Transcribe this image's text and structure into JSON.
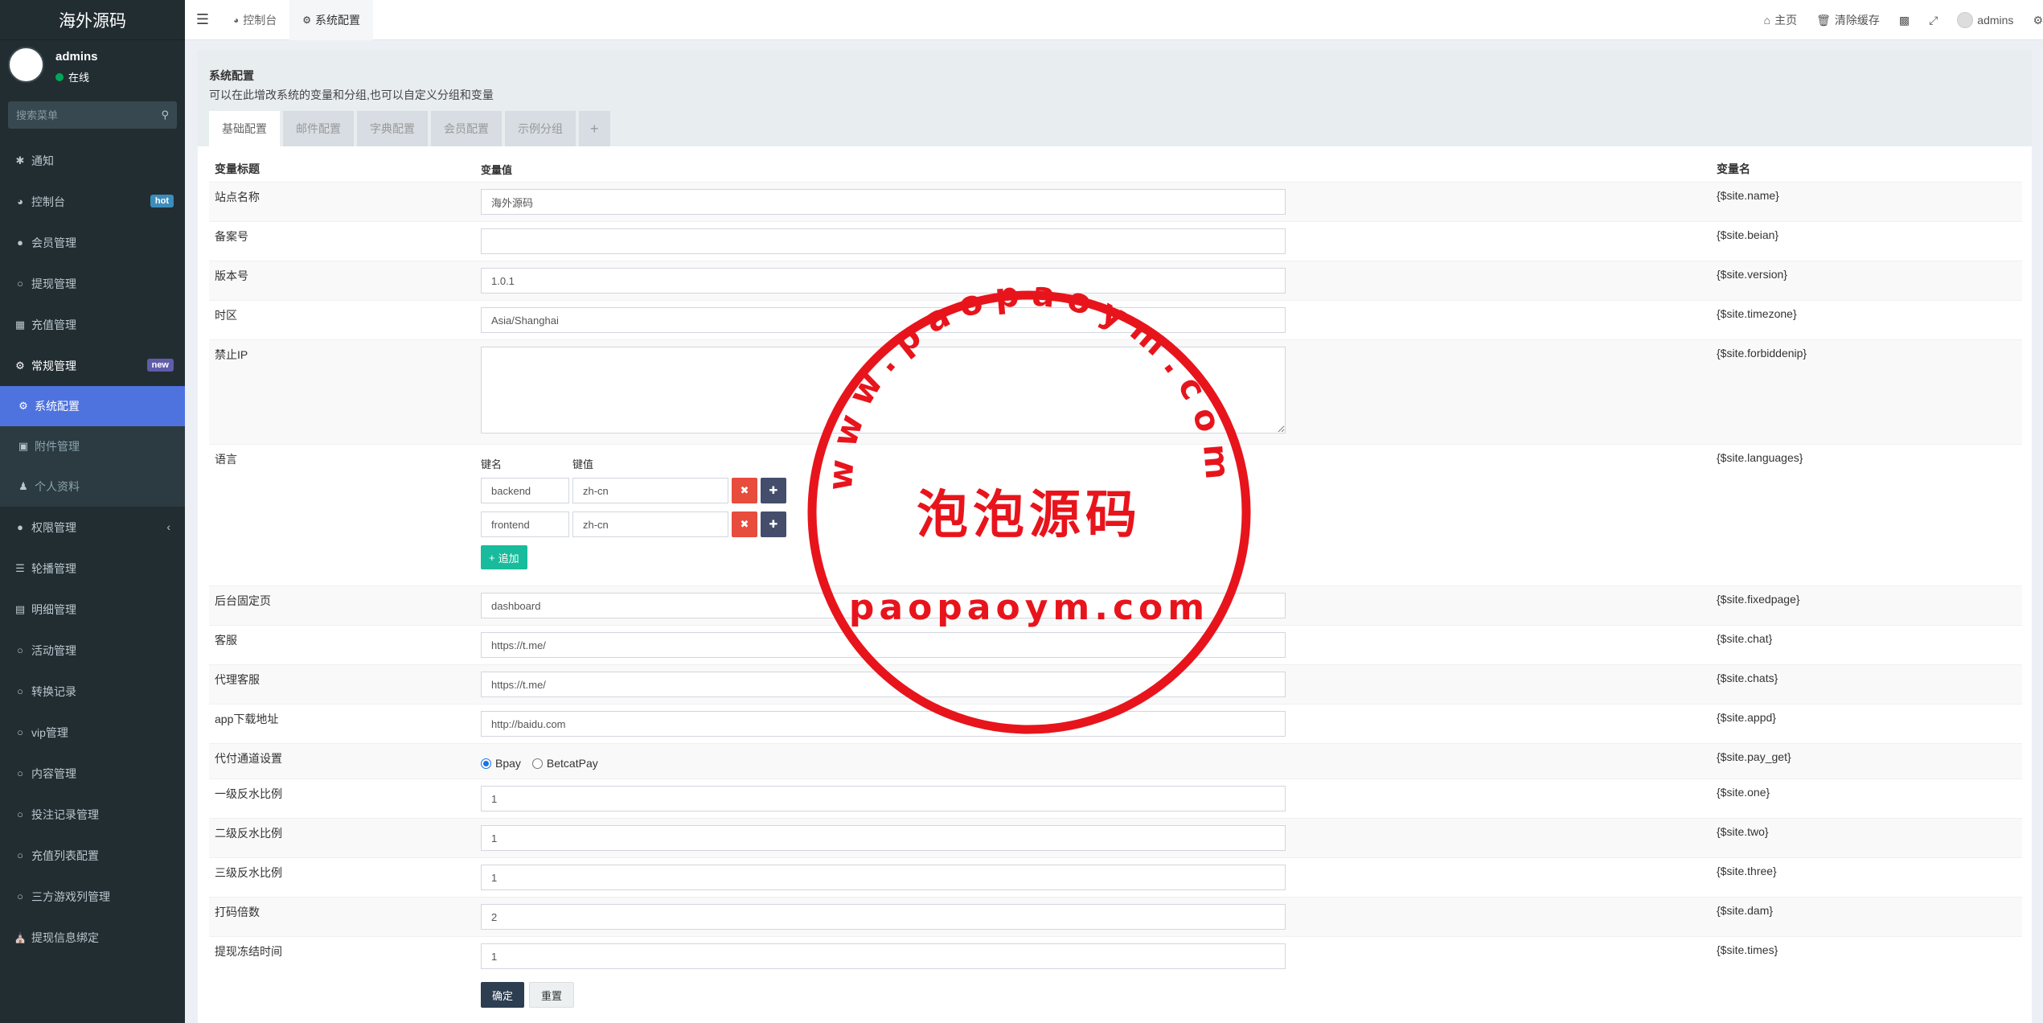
{
  "app": {
    "title": "海外源码"
  },
  "user": {
    "name": "admins",
    "status": "在线"
  },
  "search": {
    "placeholder": "搜索菜单"
  },
  "menu": {
    "items": [
      {
        "label": "通知"
      },
      {
        "label": "控制台",
        "badge": "hot"
      },
      {
        "label": "会员管理"
      },
      {
        "label": "提现管理"
      },
      {
        "label": "充值管理"
      },
      {
        "label": "常规管理",
        "badge": "new"
      }
    ],
    "sub": [
      {
        "label": "系统配置"
      },
      {
        "label": "附件管理"
      },
      {
        "label": "个人资料"
      }
    ],
    "items2": [
      {
        "label": "权限管理"
      },
      {
        "label": "轮播管理"
      },
      {
        "label": "明细管理"
      },
      {
        "label": "活动管理"
      },
      {
        "label": "转换记录"
      },
      {
        "label": "vip管理"
      },
      {
        "label": "内容管理"
      },
      {
        "label": "投注记录管理"
      },
      {
        "label": "充值列表配置"
      },
      {
        "label": "三方游戏列管理"
      },
      {
        "label": "提现信息绑定"
      }
    ]
  },
  "topbar": {
    "tabs": [
      {
        "label": "控制台"
      },
      {
        "label": "系统配置"
      }
    ],
    "home": "主页",
    "clear_cache": "清除缓存",
    "user": "admins"
  },
  "page": {
    "title": "系统配置",
    "desc": "可以在此增改系统的变量和分组,也可以自定义分组和变量",
    "tabs": [
      {
        "label": "基础配置"
      },
      {
        "label": "邮件配置"
      },
      {
        "label": "字典配置"
      },
      {
        "label": "会员配置"
      },
      {
        "label": "示例分组"
      },
      {
        "label": "+"
      }
    ]
  },
  "table": {
    "headers": {
      "title": "变量标题",
      "value": "变量值",
      "name": "变量名"
    },
    "rows": [
      {
        "title": "站点名称",
        "value": "海外源码",
        "name": "{$site.name}"
      },
      {
        "title": "备案号",
        "value": "",
        "name": "{$site.beian}"
      },
      {
        "title": "版本号",
        "value": "1.0.1",
        "name": "{$site.version}"
      },
      {
        "title": "时区",
        "value": "Asia/Shanghai",
        "name": "{$site.timezone}"
      },
      {
        "title": "禁止IP",
        "value": "",
        "name": "{$site.forbiddenip}"
      },
      {
        "title": "语言",
        "name": "{$site.languages}"
      },
      {
        "title": "后台固定页",
        "value": "dashboard",
        "name": "{$site.fixedpage}"
      },
      {
        "title": "客服",
        "value": "https://t.me/",
        "name": "{$site.chat}"
      },
      {
        "title": "代理客服",
        "value": "https://t.me/",
        "name": "{$site.chats}"
      },
      {
        "title": "app下载地址",
        "value": "http://baidu.com",
        "name": "{$site.appd}"
      },
      {
        "title": "代付通道设置",
        "name": "{$site.pay_get}"
      },
      {
        "title": "一级反水比例",
        "value": "1",
        "name": "{$site.one}"
      },
      {
        "title": "二级反水比例",
        "value": "1",
        "name": "{$site.two}"
      },
      {
        "title": "三级反水比例",
        "value": "1",
        "name": "{$site.three}"
      },
      {
        "title": "打码倍数",
        "value": "2",
        "name": "{$site.dam}"
      },
      {
        "title": "提现冻结时间",
        "value": "1",
        "name": "{$site.times}"
      }
    ]
  },
  "languages": {
    "key_label": "键名",
    "value_label": "键值",
    "entries": [
      {
        "key": "backend",
        "value": "zh-cn"
      },
      {
        "key": "frontend",
        "value": "zh-cn"
      }
    ],
    "add_label": "追加"
  },
  "pay_options": {
    "options": [
      "Bpay",
      "BetcatPay"
    ],
    "selected": "Bpay"
  },
  "buttons": {
    "ok": "确定",
    "reset": "重置"
  },
  "watermark": {
    "arc_text": "www.paopaoym.com",
    "center_text": "泡泡源码",
    "bottom_text": "paopaoym.com",
    "color": "#e8141c"
  },
  "colors": {
    "sidebar": "#222d32",
    "active": "#4e73df",
    "danger": "#e74c3c",
    "success": "#18bc9c"
  }
}
